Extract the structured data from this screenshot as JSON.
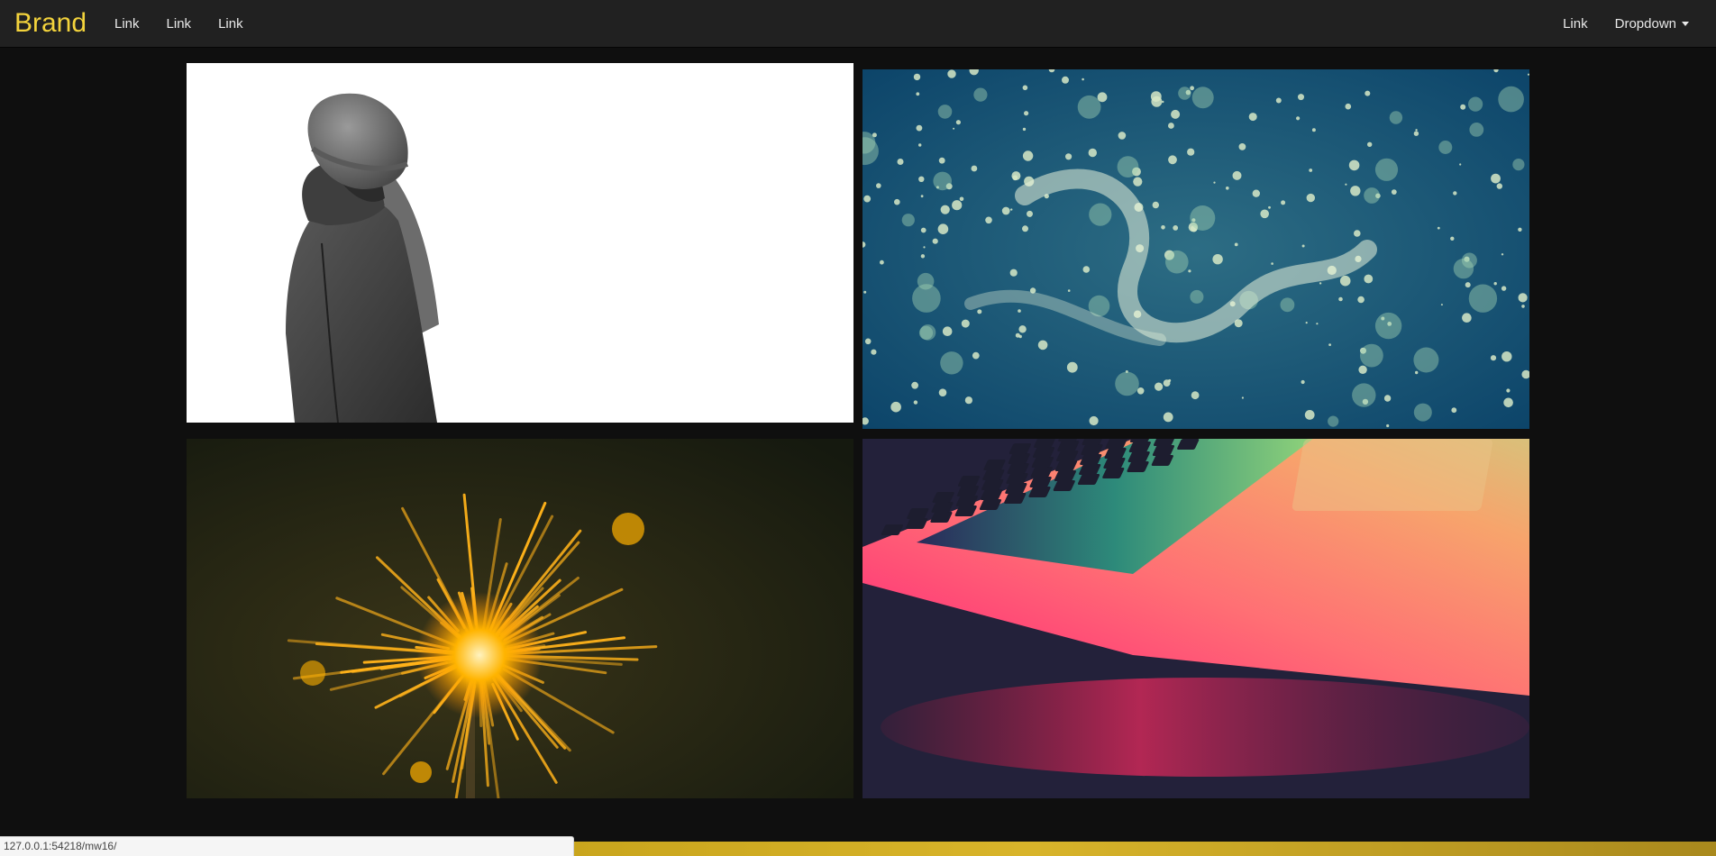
{
  "navbar": {
    "brand": "Brand",
    "left_links": [
      "Link",
      "Link",
      "Link"
    ],
    "right_link": "Link",
    "dropdown": "Dropdown"
  },
  "gallery": {
    "tiles": [
      {
        "subject": "person in knit beanie and hooded coat on white background"
      },
      {
        "subject": "water splash droplets on blue"
      },
      {
        "subject": "sparkler with orange sparks on dark background"
      },
      {
        "subject": "laptop keyboard lit with pink and rainbow light"
      }
    ]
  },
  "status": {
    "url": "127.0.0.1:54218/mw16/"
  },
  "colors": {
    "brand": "#f3d33c",
    "navbar_bg": "#212121",
    "page_bg": "#0f0f0f"
  }
}
